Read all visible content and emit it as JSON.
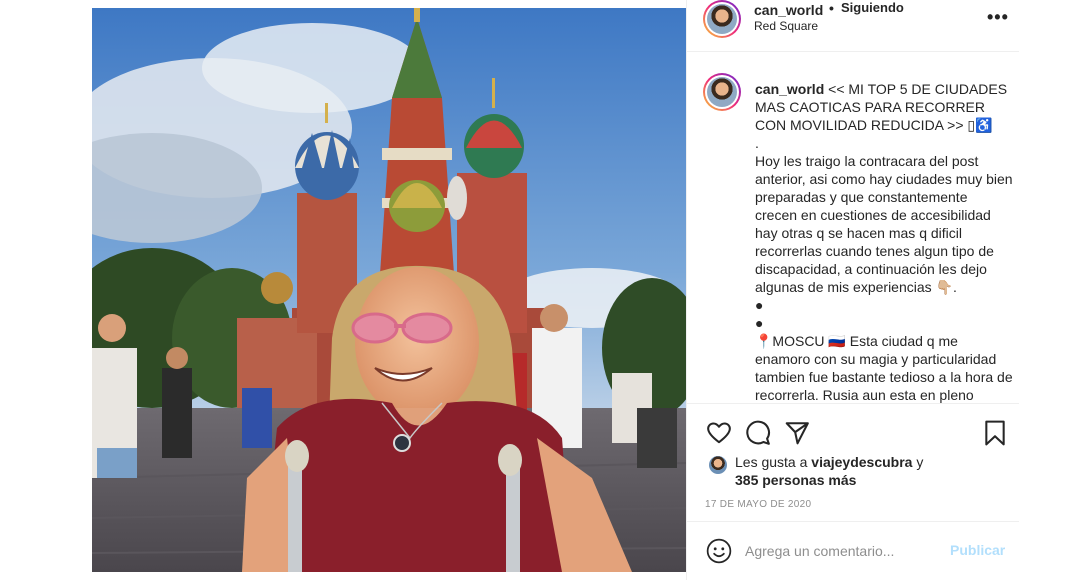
{
  "header": {
    "username": "can_world",
    "separator": "•",
    "follow_status": "Siguiendo",
    "location": "Red Square",
    "more_icon": "more-horizontal-icon"
  },
  "caption": {
    "username": "can_world",
    "lines": [
      "<< MI TOP 5 DE CIUDADES MAS CAOTICAS PARA RECORRER CON MOVILIDAD REDUCIDA >> ▯♿",
      ".",
      "Hoy les traigo la contracara del post anterior, asi como hay ciudades muy bien preparadas y que constantemente crecen en cuestiones de accesibilidad hay otras q se hacen mas q dificil recorrerlas cuando tenes algun tipo de discapacidad, a continuación les dejo algunas de mis experiencias 👇🏼.",
      "●",
      "●",
      "📍MOSCU 🇷🇺 Esta ciudad q me enamoro con su magia y particularidad tambien fue bastante tedioso a la hora de recorrerla. Rusia aun esta en pleno"
    ]
  },
  "actions": {
    "like_icon": "heart-icon",
    "comment_icon": "comment-icon",
    "share_icon": "share-icon",
    "save_icon": "bookmark-icon"
  },
  "likes": {
    "prefix": "Les gusta a",
    "liker": "viajeydescubra",
    "suffix": "y",
    "others": "385 personas más"
  },
  "date": "17 DE MAYO DE 2020",
  "comment": {
    "placeholder": "Agrega un comentario...",
    "post_label": "Publicar",
    "emoji_icon": "smiley-icon"
  },
  "colors": {
    "text": "#262626",
    "secondary": "#8e8e8e",
    "post_disabled": "#b2dffc",
    "sky": "#5b8fcf"
  }
}
